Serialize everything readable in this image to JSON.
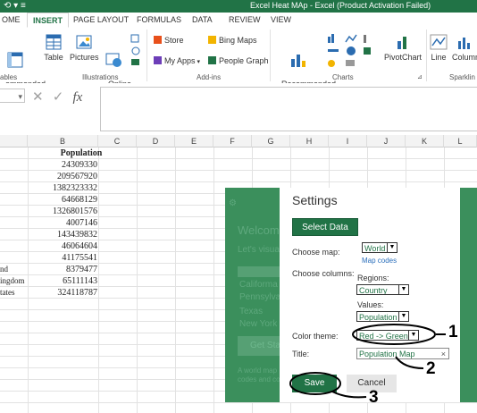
{
  "window": {
    "title": "Excel Heat MAp -  Excel (Product Activation Failed)",
    "qat": "⟲ ▾ ≡"
  },
  "tabs": [
    "OME",
    "INSERT",
    "PAGE LAYOUT",
    "FORMULAS",
    "DATA",
    "REVIEW",
    "VIEW"
  ],
  "ribbon": {
    "recommended_pivottables": "ommended\nvotTables",
    "table": "Table",
    "pictures": "Pictures",
    "online_pictures": "Online\nPictures",
    "store": "Store",
    "my_apps": "My Apps",
    "bing_maps": "Bing Maps",
    "people_graph": "People Graph",
    "recommended_charts": "Recommended\nCharts",
    "pivotchart": "PivotChart",
    "line": "Line",
    "column": "Column",
    "groups": {
      "tables": "ables",
      "illustrations": "Illustrations",
      "addins": "Add-ins",
      "charts": "Charts",
      "sparklines": "Sparklin"
    },
    "colors": {
      "brand": "#217346"
    }
  },
  "formula_bar": {
    "namebox_tail": "▾",
    "fx": "fx"
  },
  "columns": [
    "B",
    "C",
    "D",
    "E",
    "F",
    "G",
    "H",
    "I",
    "J",
    "K",
    "L"
  ],
  "sheet": {
    "header": "Population",
    "rows": [
      {
        "a": "",
        "b": "24309330"
      },
      {
        "a": "",
        "b": "209567920"
      },
      {
        "a": "",
        "b": "1382323332"
      },
      {
        "a": "",
        "b": "64668129"
      },
      {
        "a": "",
        "b": "1326801576"
      },
      {
        "a": "",
        "b": "4007146"
      },
      {
        "a": "",
        "b": "143439832"
      },
      {
        "a": "",
        "b": "46064604"
      },
      {
        "a": "",
        "b": "41175541"
      },
      {
        "a": "nd",
        "b": "8379477"
      },
      {
        "a": "ingdom",
        "b": "65111143"
      },
      {
        "a": "tates",
        "b": "324118787"
      }
    ]
  },
  "addin_background": {
    "welcome": "Welcom",
    "lets": "Let's visual",
    "lines": [
      "Califorma",
      "Pennsylva",
      "Texas",
      "New York"
    ],
    "get_started": "Get Sta",
    "footer1": "A world map",
    "footer2": "codes and co"
  },
  "settings": {
    "title": "Settings",
    "select_data": "Select Data",
    "choose_map_label": "Choose map:",
    "map_value": "World",
    "map_codes_link": "Map codes",
    "choose_columns_label": "Choose columns:",
    "regions_label": "Regions:",
    "regions_value": "Country",
    "values_label": "Values:",
    "values_value": "Population",
    "color_theme_label": "Color theme:",
    "color_theme_value": "Red -> Green",
    "title_label": "Title:",
    "title_value": "Population Map",
    "clear_glyph": "×",
    "save": "Save",
    "cancel": "Cancel"
  },
  "annotations": [
    "1",
    "2",
    "3"
  ]
}
